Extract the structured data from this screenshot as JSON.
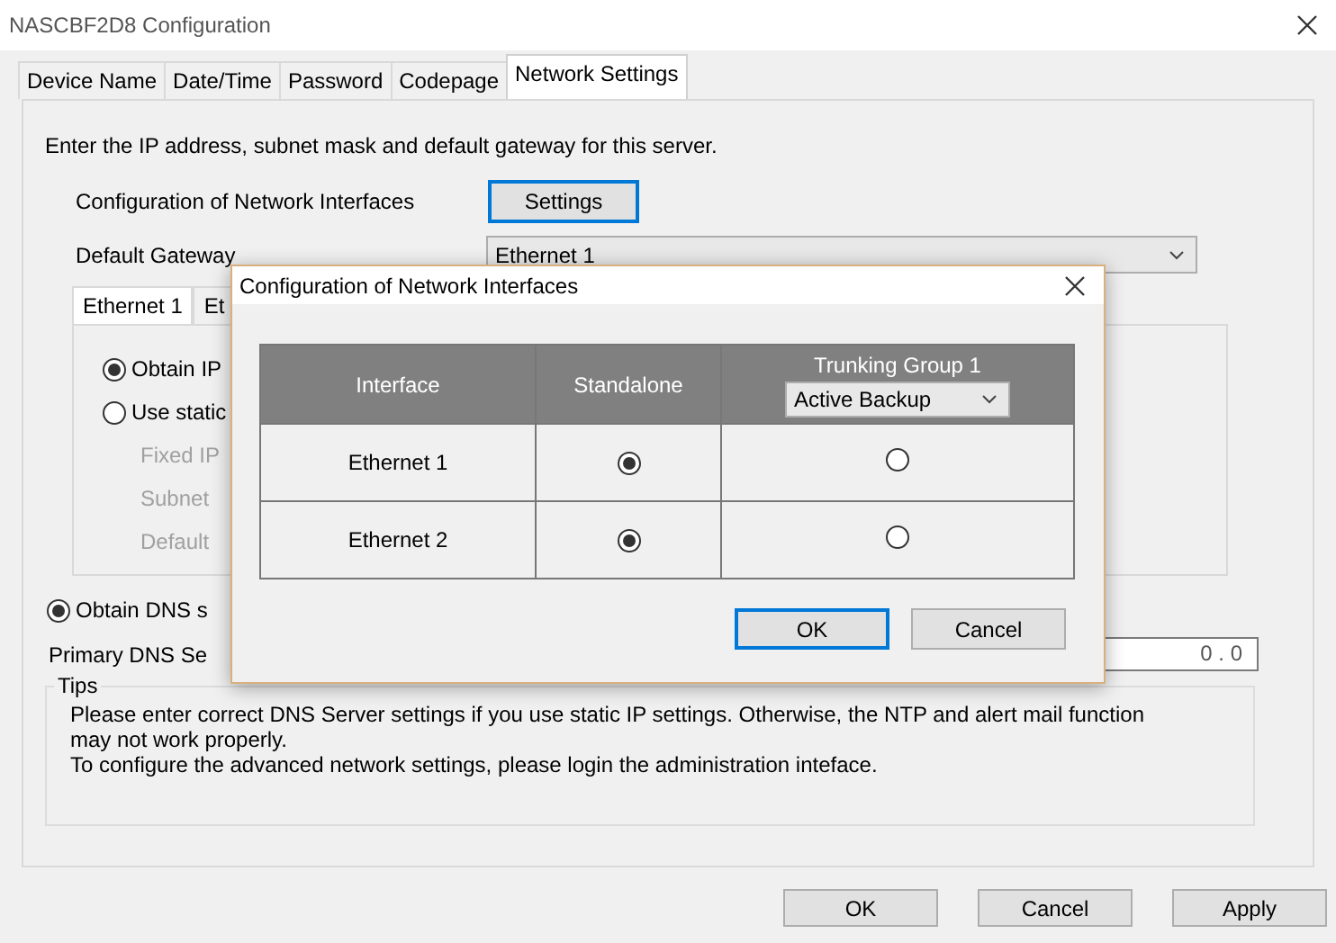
{
  "window": {
    "title": "NASCBF2D8 Configuration"
  },
  "tabs": [
    {
      "label": "Device Name",
      "selected": false
    },
    {
      "label": "Date/Time",
      "selected": false
    },
    {
      "label": "Password",
      "selected": false
    },
    {
      "label": "Codepage",
      "selected": false
    },
    {
      "label": "Network Settings",
      "selected": true
    }
  ],
  "network_settings": {
    "intro": "Enter the IP address, subnet mask and default gateway for this server.",
    "interfaces_label": "Configuration of Network Interfaces",
    "settings_button": "Settings",
    "gateway_label": "Default Gateway",
    "gateway_select": {
      "value": "Ethernet 1"
    },
    "interface_tabs": [
      {
        "label": "Ethernet 1",
        "selected": true
      },
      {
        "label": "Et",
        "selected": false
      }
    ],
    "ip_options": [
      {
        "label": "Obtain IP",
        "selected": true
      },
      {
        "label": "Use static",
        "selected": false
      }
    ],
    "static_fields": [
      {
        "label": "Fixed IP",
        "disabled": true
      },
      {
        "label": "Subnet",
        "disabled": true
      },
      {
        "label": "Default",
        "disabled": true
      }
    ],
    "dns_option": {
      "label": "Obtain DNS s",
      "selected": true
    },
    "primary_dns": {
      "label": "Primary DNS Se",
      "value": "0 . 0"
    },
    "tips": {
      "title": "Tips",
      "lines": [
        "Please enter correct DNS Server settings if you use static IP settings.  Otherwise, the NTP and alert mail function may not work properly.",
        "To configure the advanced network settings, please login the administration inteface."
      ]
    }
  },
  "buttons": [
    {
      "label": "OK"
    },
    {
      "label": "Cancel"
    },
    {
      "label": "Apply"
    }
  ],
  "dialog": {
    "title": "Configuration of Network Interfaces",
    "columns": [
      "Interface",
      "Standalone",
      "Trunking Group 1"
    ],
    "mode_select": {
      "value": "Active Backup"
    },
    "rows": [
      {
        "interface": "Ethernet 1",
        "standalone": true,
        "trunking": false
      },
      {
        "interface": "Ethernet 2",
        "standalone": true,
        "trunking": false
      }
    ],
    "buttons": [
      {
        "label": "OK",
        "default": true
      },
      {
        "label": "Cancel",
        "default": false
      }
    ]
  }
}
